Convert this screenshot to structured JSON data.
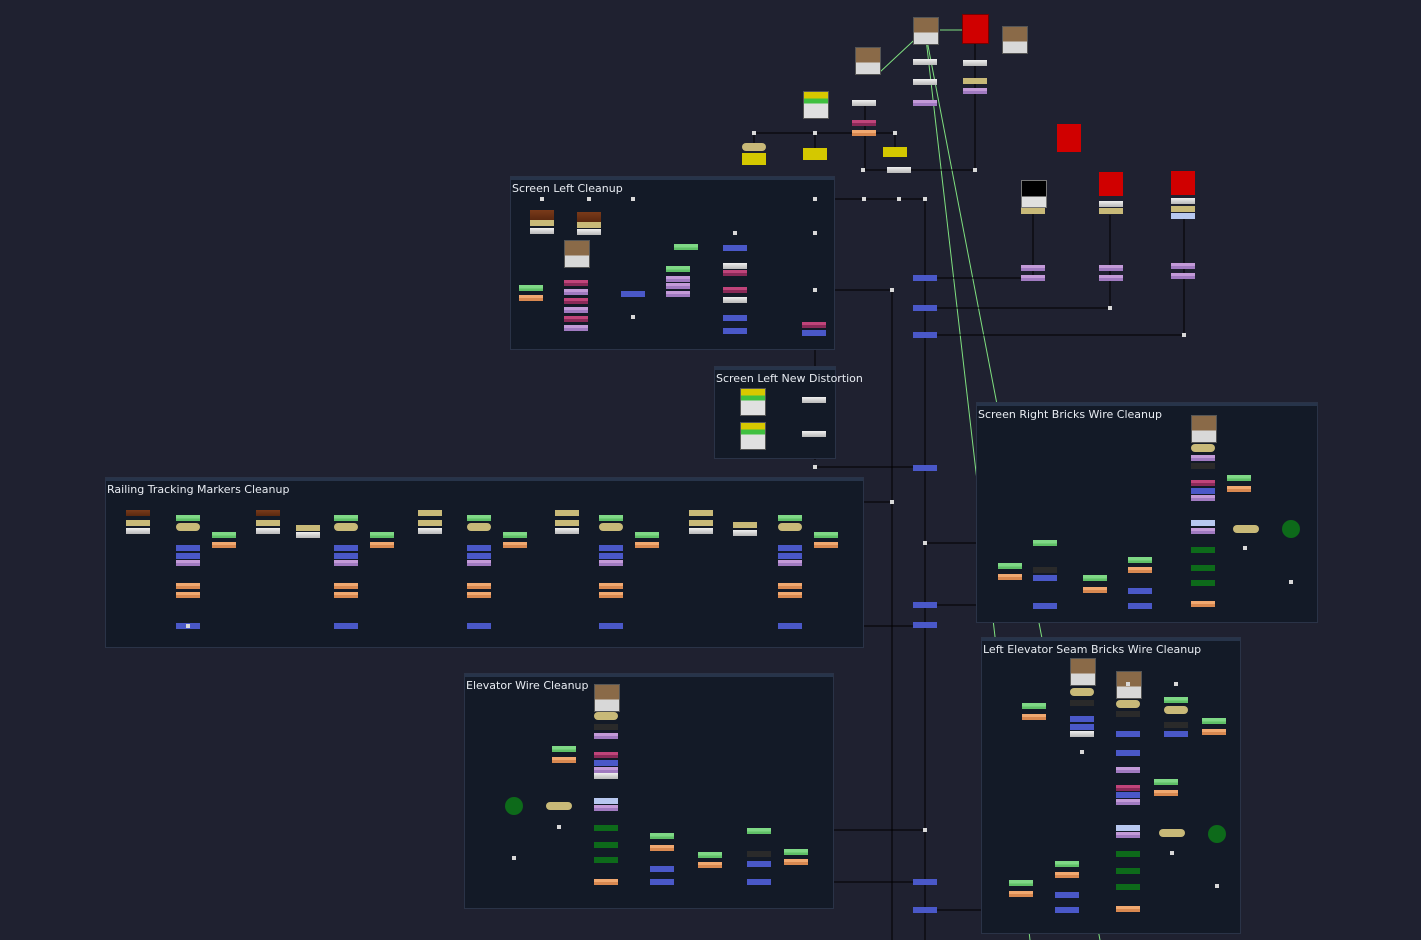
{
  "app": {
    "view": "node-graph",
    "backdrop_color": "#131a27",
    "background_color": "#1f2130",
    "pipe_color": "#000000",
    "mask_pipe_color": "#7fe07f"
  },
  "backdrops": [
    {
      "id": "screen-left-cleanup",
      "label": "Screen Left Cleanup"
    },
    {
      "id": "screen-left-new-distortion",
      "label": "Screen Left New Distortion"
    },
    {
      "id": "screen-right-bricks-wire-cleanup",
      "label": "Screen Right Bricks Wire Cleanup"
    },
    {
      "id": "railing-tracking-markers-cleanup",
      "label": "Railing Tracking Markers Cleanup"
    },
    {
      "id": "elevator-wire-cleanup",
      "label": "Elevator Wire Cleanup"
    },
    {
      "id": "left-elevator-seam-bricks-wire-cleanup",
      "label": "Left Elevator Seam Bricks Wire Cleanup"
    }
  ],
  "node_types": {
    "read": "film-thumbnail-icon",
    "constant": "red-square-icon",
    "ramp": "gradient-thumbnail-icon",
    "grade": "#e6e6e6",
    "merge": "#c8b978",
    "transform": "#9aa0e6",
    "roto": "#80d07a",
    "colorcorrect": "#e09050",
    "dot": "#d8d8d8",
    "switch": "#1a7a1a"
  }
}
